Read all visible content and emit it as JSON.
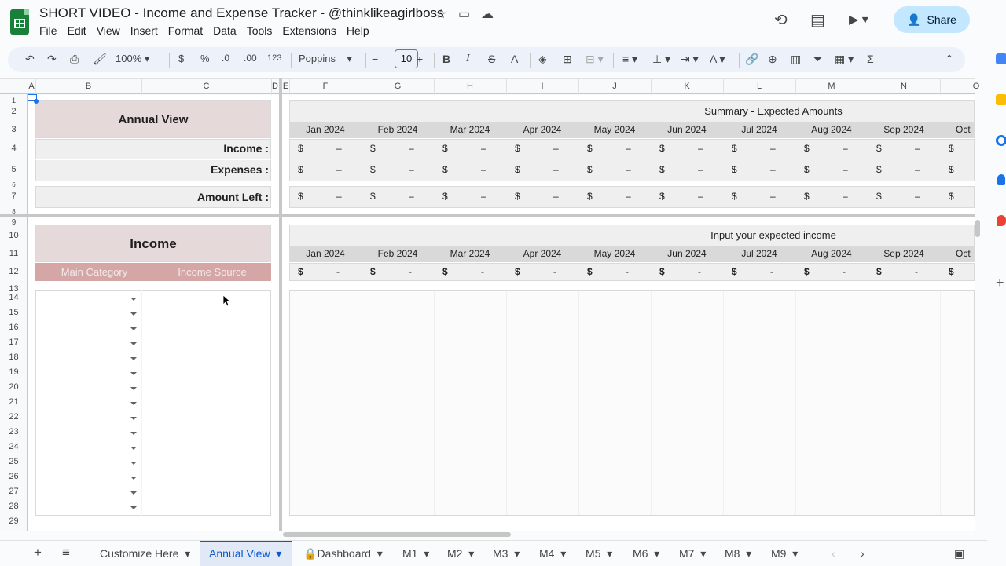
{
  "doc": {
    "title": "SHORT VIDEO - Income and Expense Tracker - @thinklikeagirlboss",
    "menu": [
      "File",
      "Edit",
      "View",
      "Insert",
      "Format",
      "Data",
      "Tools",
      "Extensions",
      "Help"
    ],
    "share_label": "Share"
  },
  "toolbar": {
    "zoom": "100%",
    "currency": "$",
    "percent": "%",
    "dec_decrease": ".0",
    "dec_increase": ".00",
    "number_format": "123",
    "font": "Poppins",
    "font_size": "10",
    "bold": "B",
    "italic": "I",
    "strike": "S",
    "text_color": "A",
    "sum": "Σ"
  },
  "columns": [
    "A",
    "B",
    "C",
    "D",
    "E",
    "F",
    "G",
    "H",
    "I",
    "J",
    "K",
    "L",
    "M",
    "N",
    "O"
  ],
  "rows": [
    "1",
    "2",
    "3",
    "4",
    "5",
    "6",
    "7",
    "8",
    "9",
    "10",
    "11",
    "12",
    "13",
    "14",
    "15",
    "16",
    "17",
    "18",
    "19",
    "20",
    "21",
    "22",
    "23",
    "24",
    "25",
    "26",
    "27",
    "28",
    "29"
  ],
  "annual": {
    "title": "Annual View",
    "income_label": "Income :",
    "expenses_label": "Expenses :",
    "left_label": "Amount Left :"
  },
  "summary": {
    "title": "Summary - Expected Amounts",
    "months": [
      "Jan 2024",
      "Feb 2024",
      "Mar 2024",
      "Apr 2024",
      "May 2024",
      "Jun 2024",
      "Jul 2024",
      "Aug 2024",
      "Sep 2024",
      "Oct"
    ],
    "currency": "$",
    "dash": "–"
  },
  "income": {
    "title": "Income",
    "col_main": "Main Category",
    "col_source": "Income Source",
    "input_title": "Input your expected income",
    "months": [
      "Jan 2024",
      "Feb 2024",
      "Mar 2024",
      "Apr 2024",
      "May 2024",
      "Jun 2024",
      "Jul 2024",
      "Aug 2024",
      "Sep 2024",
      "Oct"
    ],
    "currency": "$",
    "dash": "-"
  },
  "tabs": {
    "add": "+",
    "list": "≡",
    "items": [
      "Customize Here",
      "Annual View",
      "Dashboard",
      "M1",
      "M2",
      "M3",
      "M4",
      "M5",
      "M6",
      "M7",
      "M8",
      "M9"
    ],
    "active": "Annual View"
  },
  "colors": {
    "accent": "#0b57d0",
    "header_pink": "#d5a6a6",
    "box_pink": "#e6d9d9",
    "share_bg": "#c2e7ff"
  }
}
